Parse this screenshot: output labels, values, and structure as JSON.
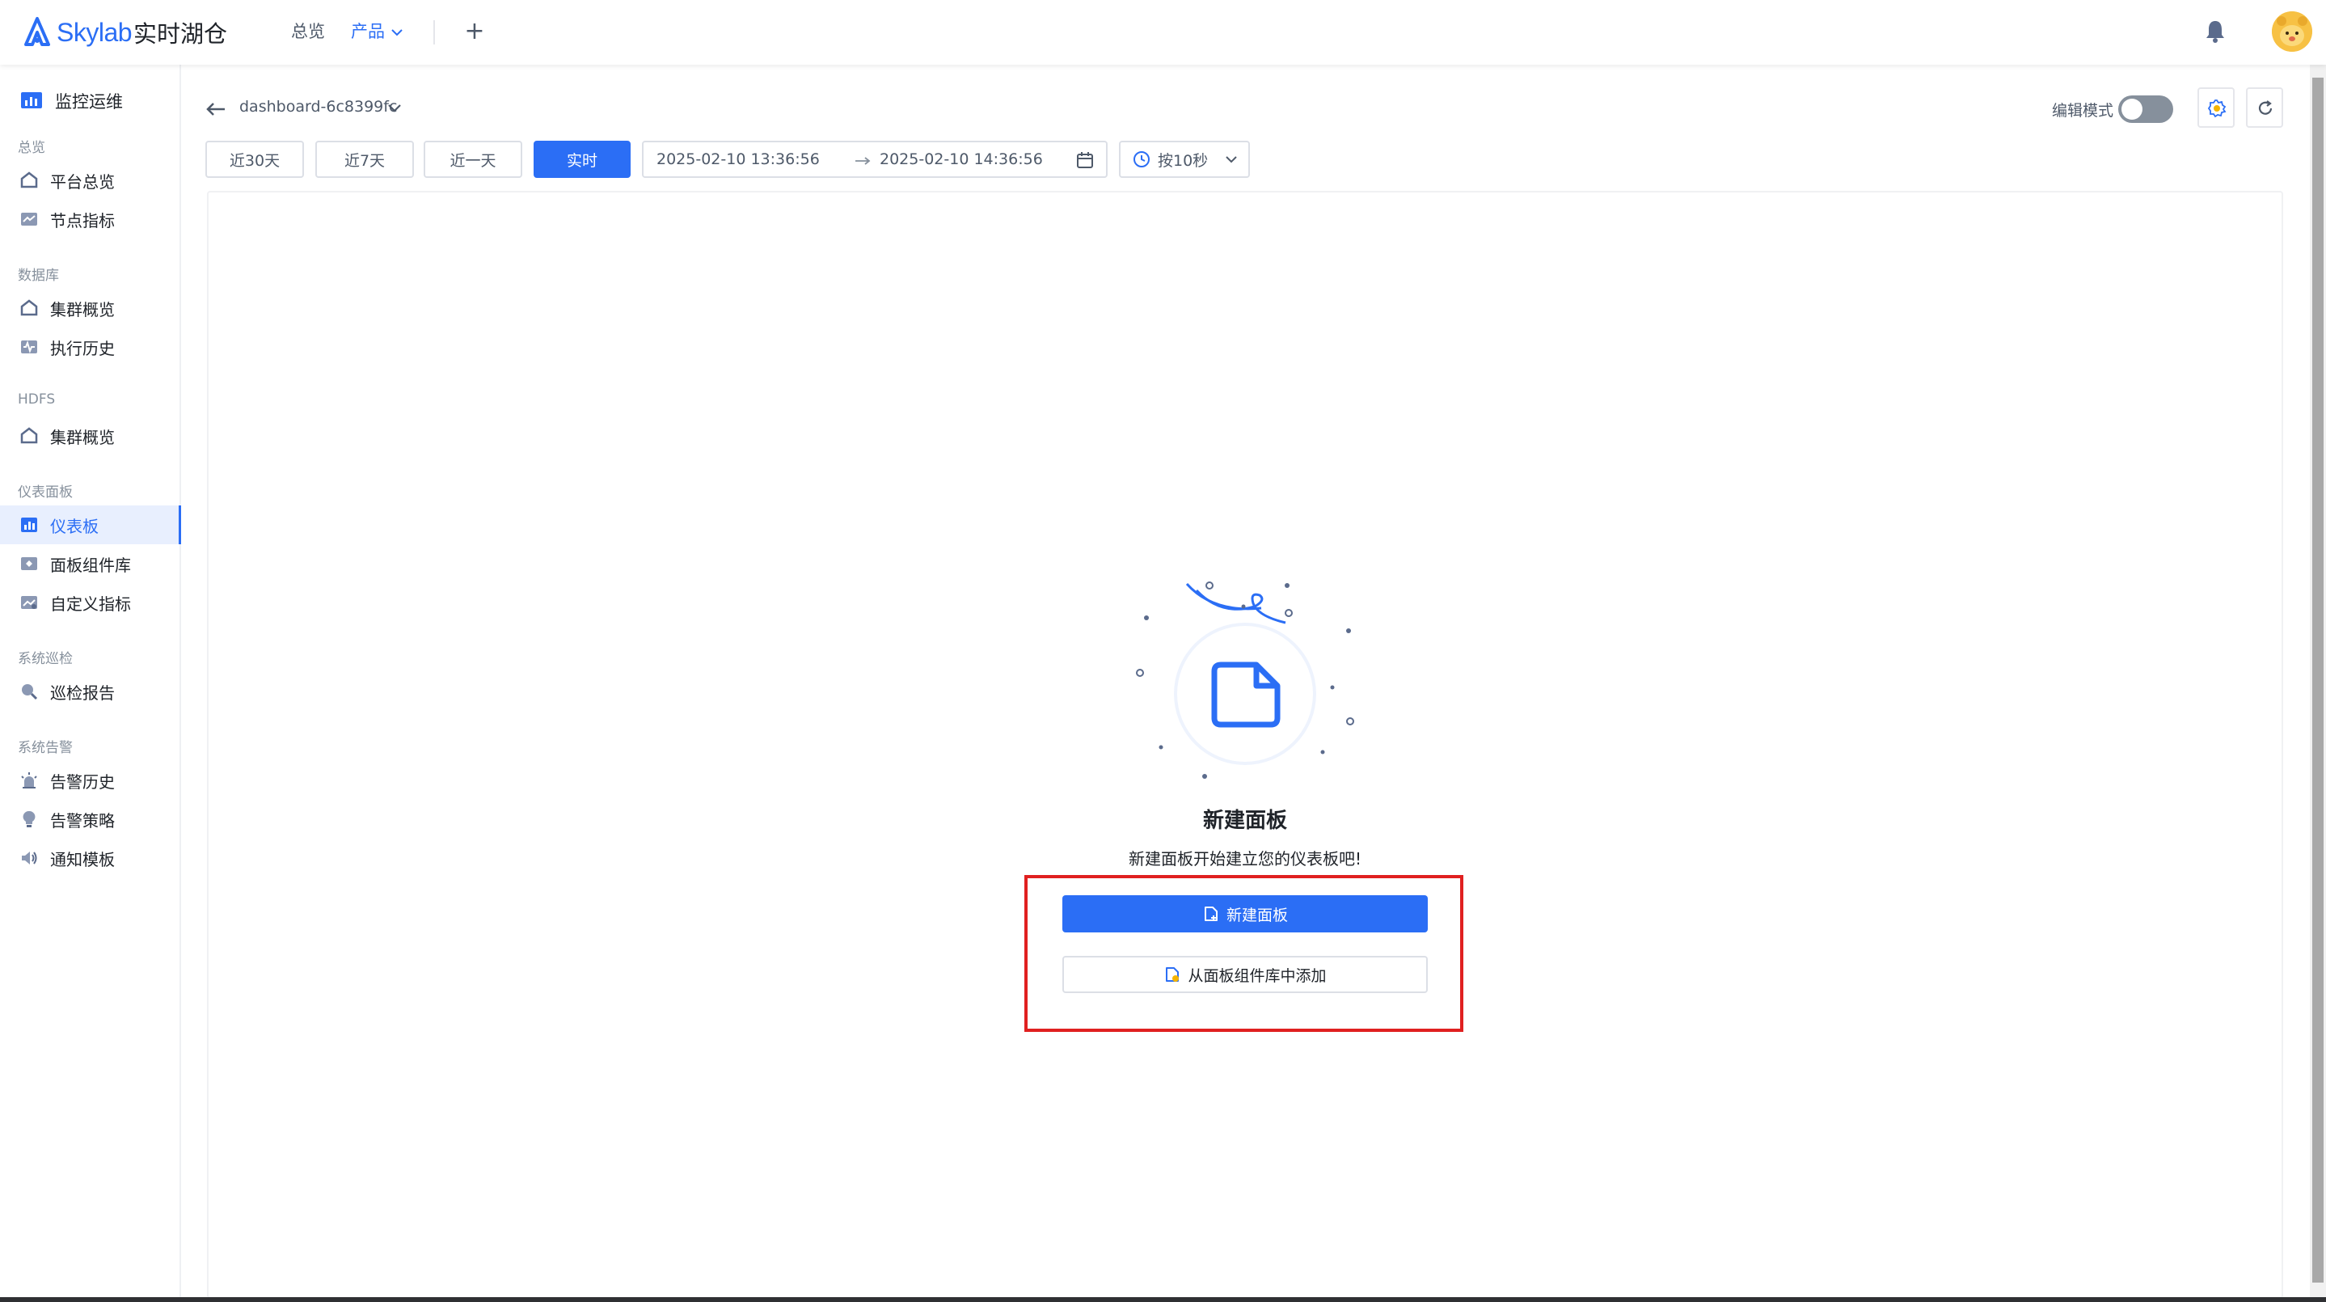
{
  "topnav": {
    "brand": "Skylab",
    "product_title": "实时湖仓",
    "overview_label": "总览",
    "product_label": "产品",
    "add_label": "+"
  },
  "sidebar": {
    "header_label": "监控运维",
    "groups": [
      {
        "title": "总览",
        "items": [
          {
            "label": "平台总览",
            "icon": "home-icon"
          },
          {
            "label": "节点指标",
            "icon": "line-chart-icon"
          }
        ]
      },
      {
        "title": "数据库",
        "items": [
          {
            "label": "集群概览",
            "icon": "home-icon"
          },
          {
            "label": "执行历史",
            "icon": "waveform-icon"
          }
        ]
      },
      {
        "title": "HDFS",
        "items": [
          {
            "label": "集群概览",
            "icon": "home-icon"
          }
        ]
      },
      {
        "title": "仪表面板",
        "items": [
          {
            "label": "仪表板",
            "icon": "dashboard-icon",
            "active": true
          },
          {
            "label": "面板组件库",
            "icon": "component-icon"
          },
          {
            "label": "自定义指标",
            "icon": "metric-icon"
          }
        ]
      },
      {
        "title": "系统巡检",
        "items": [
          {
            "label": "巡检报告",
            "icon": "search-icon"
          }
        ]
      },
      {
        "title": "系统告警",
        "items": [
          {
            "label": "告警历史",
            "icon": "alarm-icon"
          },
          {
            "label": "告警策略",
            "icon": "bulb-icon"
          },
          {
            "label": "通知模板",
            "icon": "speaker-icon"
          }
        ]
      }
    ]
  },
  "header": {
    "dashboard_name": "dashboard-6c8399fc",
    "edit_mode_label": "编辑模式",
    "edit_mode_on": false
  },
  "toolbar": {
    "range_buttons": [
      "近30天",
      "近7天",
      "近一天",
      "实时"
    ],
    "active_range": "实时",
    "start_time": "2025-02-10 13:36:56",
    "end_time": "2025-02-10 14:36:56",
    "interval_label": "按10秒"
  },
  "empty": {
    "title": "新建面板",
    "description": "新建面板开始建立您的仪表板吧!",
    "create_button": "新建面板",
    "library_button": "从面板组件库中添加"
  },
  "colors": {
    "accent": "#2b6ef5",
    "highlight": "#e02020",
    "active_bg": "#e8effe"
  }
}
